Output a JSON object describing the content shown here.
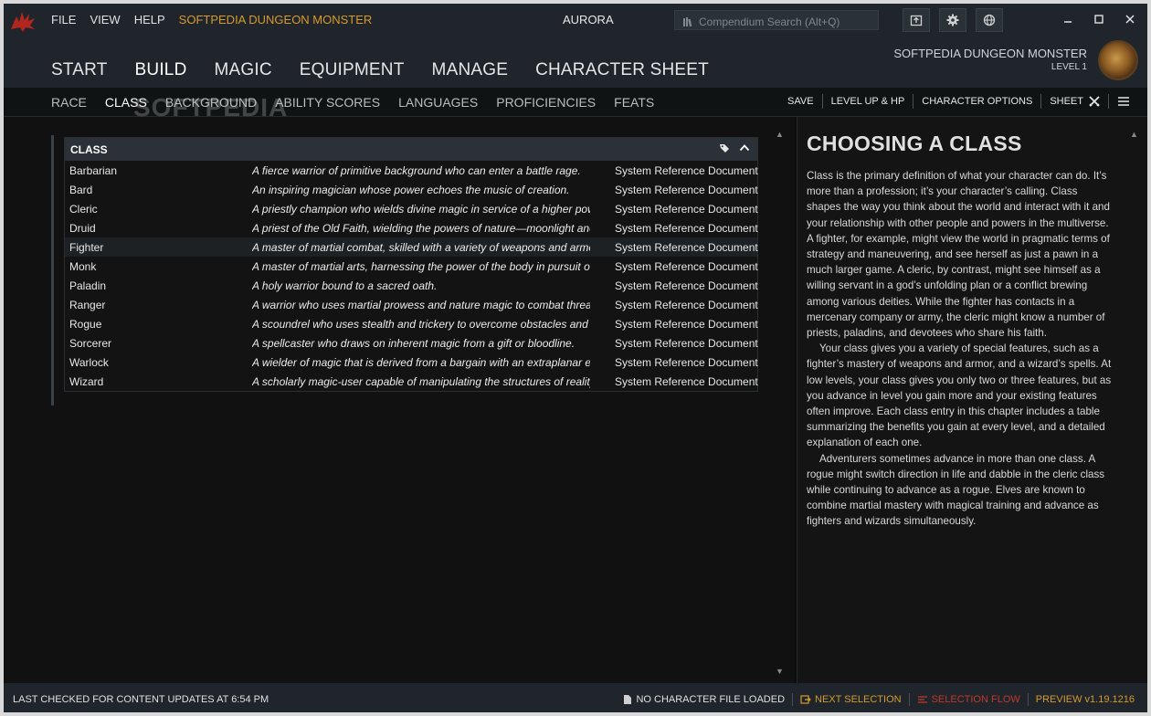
{
  "window": {
    "menu": [
      "FILE",
      "VIEW",
      "HELP"
    ],
    "brand": "SOFTPEDIA DUNGEON MONSTER",
    "title": "AURORA",
    "search_placeholder": "Compendium Search  (Alt+Q)"
  },
  "main_tabs": [
    "START",
    "BUILD",
    "MAGIC",
    "EQUIPMENT",
    "MANAGE",
    "CHARACTER SHEET"
  ],
  "character": {
    "name": "SOFTPEDIA DUNGEON MONSTER",
    "level": "LEVEL 1"
  },
  "sub_tabs": [
    "RACE",
    "CLASS",
    "BACKGROUND",
    "ABILITY SCORES",
    "LANGUAGES",
    "PROFICIENCIES",
    "FEATS"
  ],
  "watermark": "SOFTPEDIA",
  "actions": [
    "SAVE",
    "LEVEL UP & HP",
    "CHARACTER OPTIONS",
    "SHEET"
  ],
  "class_table": {
    "header": "CLASS",
    "rows": [
      {
        "name": "Barbarian",
        "desc": "A fierce warrior of primitive background who can enter a battle rage.",
        "src": "System Reference Document"
      },
      {
        "name": "Bard",
        "desc": "An inspiring magician whose power echoes the music of creation.",
        "src": "System Reference Document"
      },
      {
        "name": "Cleric",
        "desc": "A priestly champion who wields divine magic in service of a higher pow",
        "src": "System Reference Document"
      },
      {
        "name": "Druid",
        "desc": "A priest of the Old Faith, wielding the powers of nature—moonlight anc",
        "src": "System Reference Document"
      },
      {
        "name": "Fighter",
        "desc": "A master of martial combat, skilled with a variety of weapons and armc",
        "src": "System Reference Document"
      },
      {
        "name": "Monk",
        "desc": "A master of martial arts, harnessing the power of the body in pursuit of",
        "src": "System Reference Document"
      },
      {
        "name": "Paladin",
        "desc": "A holy warrior bound to a sacred oath.",
        "src": "System Reference Document"
      },
      {
        "name": "Ranger",
        "desc": "A warrior who uses martial prowess and nature magic to combat threat",
        "src": "System Reference Document"
      },
      {
        "name": "Rogue",
        "desc": "A scoundrel who uses stealth and trickery to overcome obstacles and en",
        "src": "System Reference Document"
      },
      {
        "name": "Sorcerer",
        "desc": "A spellcaster who draws on inherent magic from a gift or bloodline.",
        "src": "System Reference Document"
      },
      {
        "name": "Warlock",
        "desc": "A wielder of magic that is derived from a bargain with an extraplanar e",
        "src": "System Reference Document"
      },
      {
        "name": "Wizard",
        "desc": "A scholarly magic-user capable of manipulating the structures of reality",
        "src": "System Reference Document"
      }
    ]
  },
  "info": {
    "title": "CHOOSING A CLASS",
    "p1": "Class is the primary definition of what your character can do. It’s more than a profession; it’s your character’s calling. Class shapes the way you think about the world and interact with it and your relationship with other people and powers in the multiverse. A fighter, for example, might view the world in pragmatic terms of strategy and maneuvering, and see herself as just a pawn in a much larger game. A cleric, by contrast, might see himself as a willing servant in a god’s unfolding plan or a conflict brewing among various deities. While the fighter has contacts in a mercenary company or army, the cleric might know a number of priests, paladins, and devotees who share his faith.",
    "p2": "Your class gives you a variety of special features, such as a fighter’s mastery of weapons and armor, and a wizard’s spells. At low levels, your class gives you only two or three features, but as you advance in level you gain more and your existing features often improve. Each class entry in this chapter includes a table summarizing the benefits you gain at every level, and a detailed explanation of each one.",
    "p3": "Adventurers sometimes advance in more than one class. A rogue might switch direction in life and dabble in the cleric class while continuing to advance as a rogue. Elves are known to combine martial mastery with magical training and advance as fighters and wizards simultaneously."
  },
  "status": {
    "left": "LAST CHECKED FOR CONTENT UPDATES AT 6:54 PM",
    "file": "NO CHARACTER FILE LOADED",
    "next": "NEXT SELECTION",
    "flow": "SELECTION FLOW",
    "version": "PREVIEW v1.19.1216"
  },
  "colors": {
    "accent": "#d69a2d",
    "flow": "#c0392b",
    "header_bg": "#1f252a",
    "panel_bg": "#111111"
  }
}
